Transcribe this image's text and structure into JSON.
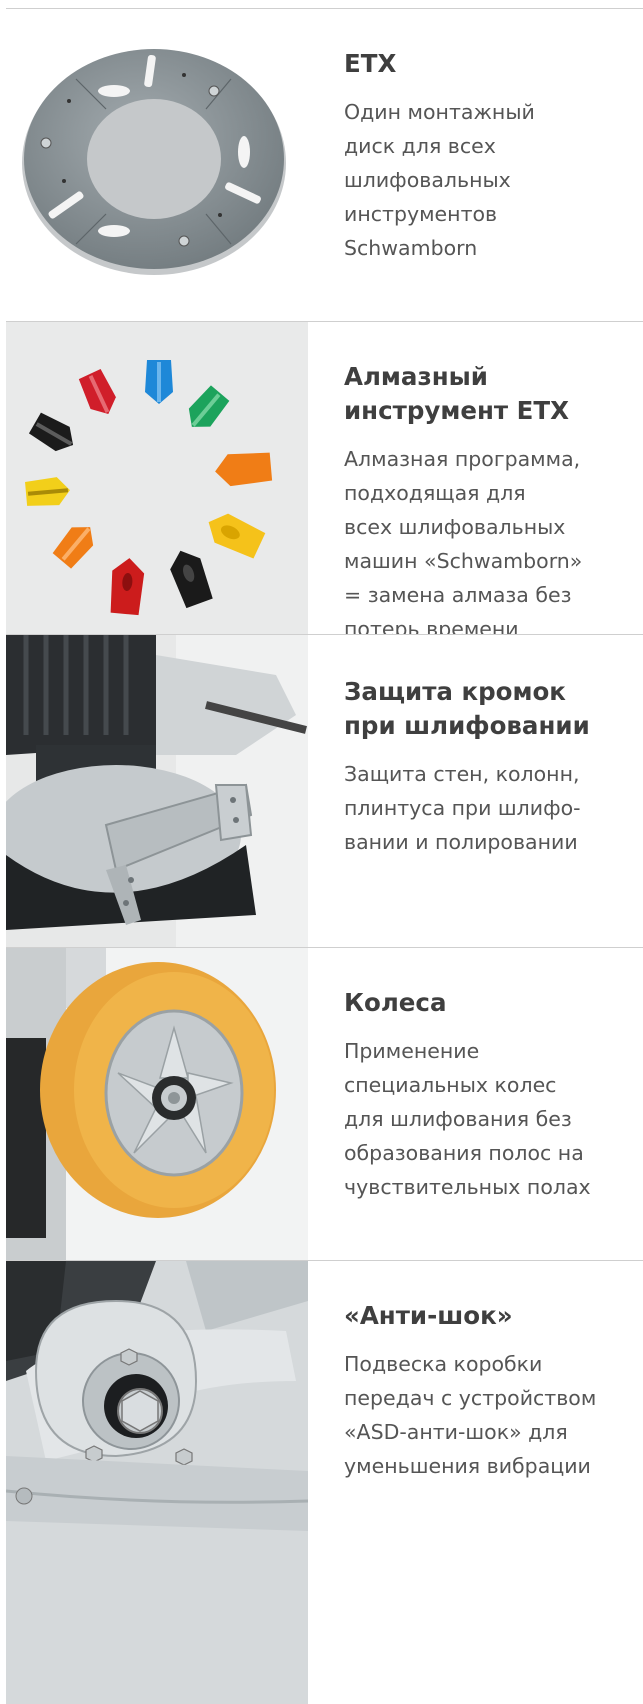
{
  "items": [
    {
      "title": "ETX",
      "description": "Один монтажный\nдиск для всех\nшлифовальных\nинструментов\nSchwamborn",
      "image_icon": "mounting-disc-image"
    },
    {
      "title": "Алмазный\nинструмент ETX",
      "description": "Алмазная программа,\nподходящая для\nвсех шлифовальных\nмашин «Schwamborn»\n= замена алмаза без\nпотерь времени",
      "image_icon": "diamond-tools-image"
    },
    {
      "title": "Защита кромок\nпри шлифовании",
      "description": "Защита стен, колонн,\nплинтуса при шлифо-\nвании и полировании",
      "image_icon": "edge-guard-image"
    },
    {
      "title": "Колеса",
      "description": "Применение\nспециальных колес\nдля шлифования без\nобразования полос на\nчувствительных полах",
      "image_icon": "wheel-image"
    },
    {
      "title": "«Анти-шок»",
      "description": "Подвеска коробки\nпередач с устройством\n«ASD-анти-шок» для\nуменьшения вибрации",
      "image_icon": "anti-shock-image"
    }
  ],
  "colors": {
    "border": "#cfcfcf",
    "title": "#3f3f3f",
    "text": "#555555",
    "wheel_tread": "#f0b449",
    "disc_metal": "#8a9296"
  }
}
